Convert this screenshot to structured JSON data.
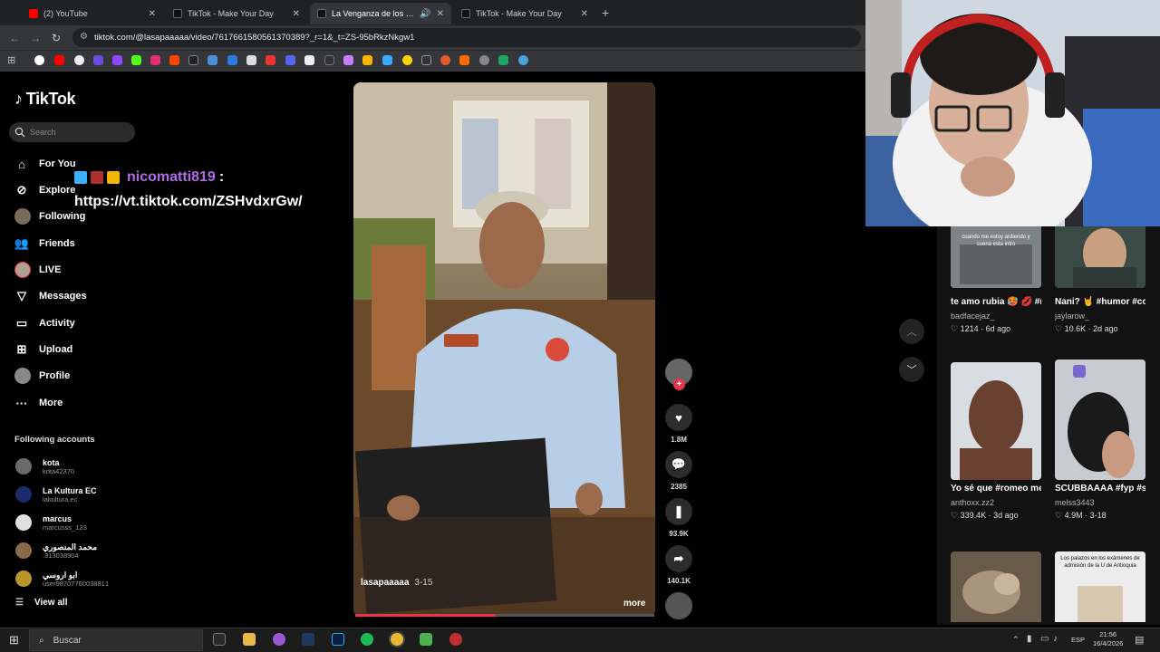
{
  "browser": {
    "tabs": [
      {
        "title": "(2) YouTube",
        "active": false,
        "favicon_color": "#ff0000"
      },
      {
        "title": "TikTok - Make Your Day",
        "active": false,
        "favicon_color": "#111111"
      },
      {
        "title": "La Venganza de los Chamo",
        "active": true,
        "favicon_color": "#111111"
      },
      {
        "title": "TikTok - Make Your Day",
        "active": false,
        "favicon_color": "#111111"
      }
    ],
    "new_tab_icon": "+",
    "url": "tiktok.com/@lasapaaaaa/video/7617661580561370389?_r=1&_t=ZS-95bRkzNkgw1"
  },
  "sidebar": {
    "logo": "TikTok",
    "search_placeholder": "Search",
    "nav": [
      {
        "label": "For You",
        "icon": "home-icon"
      },
      {
        "label": "Explore",
        "icon": "compass-icon"
      },
      {
        "label": "Following",
        "icon": "avatar-icon"
      },
      {
        "label": "Friends",
        "icon": "friends-icon"
      },
      {
        "label": "LIVE",
        "icon": "live-icon"
      },
      {
        "label": "Messages",
        "icon": "messages-icon"
      },
      {
        "label": "Activity",
        "icon": "activity-icon"
      },
      {
        "label": "Upload",
        "icon": "upload-icon"
      },
      {
        "label": "Profile",
        "icon": "profile-icon"
      },
      {
        "label": "More",
        "icon": "more-icon"
      }
    ],
    "following_title": "Following accounts",
    "accounts": [
      {
        "name": "kota",
        "handle": "kota42370",
        "color": "#6a6a6a"
      },
      {
        "name": "La Kultura EC",
        "handle": "lakultura.ec",
        "color": "#1a2a6a"
      },
      {
        "name": "marcus",
        "handle": "marcusss_123",
        "color": "#e0e0e0"
      },
      {
        "name": "محمد المنصوري",
        "handle": ".313038904",
        "color": "#8a6a4a"
      },
      {
        "name": "ابو اروسي",
        "handle": "user9870776003881‏1",
        "color": "#b8962a"
      }
    ],
    "view_all": "View all"
  },
  "overlay": {
    "username": "nicomatti819",
    "colon": ":",
    "link": "https://vt.tiktok.com/ZSHvdxrGw/"
  },
  "video": {
    "author": "lasapaaaaa",
    "date": "3-15",
    "more": "more",
    "progress": 0.47,
    "actions": {
      "likes": "1.8M",
      "comments": "2385",
      "saves": "93.9K",
      "shares": "140.1K"
    }
  },
  "recommended": [
    {
      "title": "te amo rubia 🥵 💋 #rageylo #under...",
      "author": "badfacejaz_",
      "likes": "1214",
      "age": "6d ago",
      "thumb_text": "cuando me estoy ardiendo y suena esta intro"
    },
    {
      "title": "Nani? 🤘 #humor #comedia...",
      "author": "jaylarow_",
      "likes": "10.6K",
      "age": "2d ago",
      "thumb_text": ""
    },
    {
      "title": "Yo sé que #romeo me hubiera...",
      "author": "anthoxx.zz2",
      "likes": "339.4K",
      "age": "3d ago",
      "thumb_text": ""
    },
    {
      "title": "SCUBBAAAA #fyp #scuba #funny...",
      "author": "melss3443",
      "likes": "4.9M",
      "age": "3-18",
      "thumb_text": ""
    },
    {
      "title": "",
      "author": "",
      "likes": "",
      "age": "",
      "thumb_text": ""
    },
    {
      "title": "",
      "author": "",
      "likes": "",
      "age": "",
      "thumb_text": "Los palazos en los exámenes de admisión de la U de Antioquia"
    }
  ],
  "taskbar": {
    "search": "Buscar",
    "lang": "ESP",
    "time": "21:56",
    "date": "16/4/2026"
  }
}
